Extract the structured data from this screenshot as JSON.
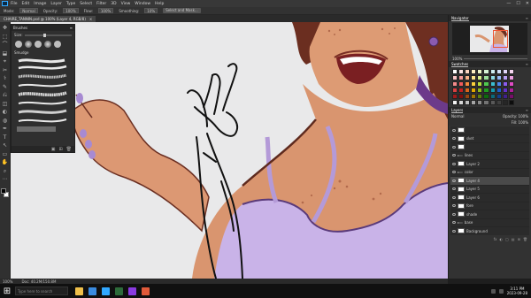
{
  "menu": [
    "File",
    "Edit",
    "Image",
    "Layer",
    "Type",
    "Select",
    "Filter",
    "3D",
    "View",
    "Window",
    "Help"
  ],
  "window_controls": [
    "—",
    "☐",
    "✕"
  ],
  "options": {
    "mode_label": "Mode:",
    "mode_value": "Normal",
    "opacity_label": "Opacity:",
    "opacity_value": "100%",
    "flow_label": "Flow:",
    "flow_value": "100%",
    "smoothing_label": "Smoothing:",
    "smoothing_value": "10%",
    "select_button": "Select and Mask..."
  },
  "document_tab": {
    "title": "CHAIRE_TANNIN.psd @ 100% (Layer 4, RGB/8)",
    "close": "×"
  },
  "tools": [
    "✥",
    "⬚",
    "⌒",
    "⬓",
    "⌖",
    "✂",
    "⚕",
    "✎",
    "⎌",
    "◫",
    "◐",
    "◍",
    "✒",
    "T",
    "↖",
    "▭",
    "✋",
    "⌕",
    "⋯"
  ],
  "brushes_panel": {
    "tab": "Brushes",
    "menu": "≡",
    "size_label": "Size:",
    "group_label": "Smudge",
    "footer_icons": [
      "▣",
      "⊞",
      "🗑"
    ]
  },
  "navigator": {
    "tab": "Navigator",
    "zoom": "100%"
  },
  "swatches": {
    "tab": "Swatches",
    "colors": [
      "#ffffff",
      "#fde6e6",
      "#fcd4c0",
      "#fff1c2",
      "#eef7c8",
      "#d6f2d6",
      "#cfeef2",
      "#d4e2fa",
      "#e1d6fa",
      "#f5d6f0",
      "#fbc3c3",
      "#f79a9a",
      "#f8b48a",
      "#fde68a",
      "#d8ee8a",
      "#9ddf9d",
      "#8ddbe6",
      "#94b8f4",
      "#b8a0f4",
      "#ec9ee0",
      "#f28b8b",
      "#ee5a5a",
      "#f48a3c",
      "#fbd13c",
      "#b8de3c",
      "#4fc74f",
      "#3cbcd0",
      "#4c86ec",
      "#8c5cec",
      "#de4cc4",
      "#d94040",
      "#c21f1f",
      "#d8661a",
      "#e0a800",
      "#8cb81a",
      "#1f9a1f",
      "#139aae",
      "#1f5ec8",
      "#6230c8",
      "#b0209a",
      "#9e1a1a",
      "#7e0e0e",
      "#964610",
      "#9e7400",
      "#5e7e0e",
      "#0e6a0e",
      "#0c6a7a",
      "#123e8c",
      "#40208c",
      "#780e6a",
      "#f2f2f2",
      "#d9d9d9",
      "#bfbfbf",
      "#a6a6a6",
      "#8c8c8c",
      "#737373",
      "#595959",
      "#404040",
      "#262626",
      "#0d0d0d"
    ]
  },
  "layers_panel": {
    "tab": "Layers",
    "mode": "Normal",
    "opacity": "Opacity: 100%",
    "fill": "Fill: 100%",
    "layers": [
      {
        "name": "",
        "kind": "thumb",
        "selected": false
      },
      {
        "name": "sket",
        "kind": "thumb",
        "selected": false
      },
      {
        "name": "",
        "kind": "thumb",
        "selected": false
      },
      {
        "name": "lines",
        "kind": "folder",
        "selected": false
      },
      {
        "name": "Layer 2",
        "kind": "thumb",
        "selected": false
      },
      {
        "name": "color",
        "kind": "folder",
        "selected": false
      },
      {
        "name": "Layer 4",
        "kind": "thumb",
        "selected": true
      },
      {
        "name": "Layer 5",
        "kind": "thumb",
        "selected": false
      },
      {
        "name": "Layer 6",
        "kind": "thumb",
        "selected": false
      },
      {
        "name": "fore",
        "kind": "thumb",
        "selected": false
      },
      {
        "name": "shade",
        "kind": "thumb",
        "selected": false
      },
      {
        "name": "base",
        "kind": "folder",
        "selected": false
      },
      {
        "name": "Background",
        "kind": "thumb",
        "selected": false
      }
    ],
    "footer_icons": [
      "fx",
      "◐",
      "▢",
      "▤",
      "⊞",
      "🗑"
    ]
  },
  "status": {
    "zoom": "100%",
    "doc": "Doc: 40.2M/150.8M"
  },
  "taskbar": {
    "search_placeholder": "Type here to search",
    "apps": [
      "#f0c04a",
      "#3a8be0",
      "#31a8ff",
      "#2d6b3a",
      "#8a3ae0",
      "#e05a3a"
    ],
    "time": "3:11 PM",
    "date": "2023-09-28"
  }
}
